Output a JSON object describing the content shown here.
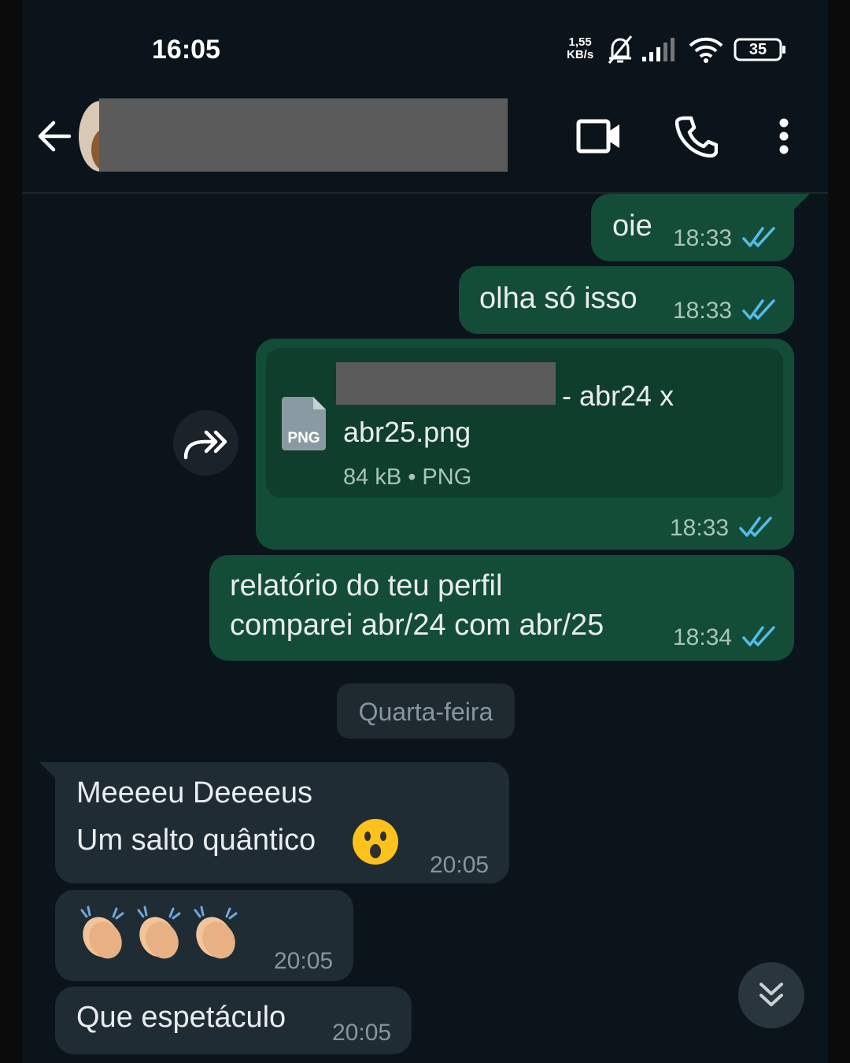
{
  "status_bar": {
    "time": "16:05",
    "net_speed_value": "1,55",
    "net_speed_unit": "KB/s",
    "battery": "35",
    "icons": [
      "mute-bell-icon",
      "signal-icon",
      "wifi-icon",
      "battery-icon"
    ]
  },
  "header": {
    "icons": [
      "back-arrow-icon",
      "video-call-icon",
      "phone-icon",
      "more-vert-icon"
    ]
  },
  "messages": {
    "m1": {
      "text": "oie",
      "time": "18:33"
    },
    "m2": {
      "text": "olha só isso",
      "time": "18:33"
    },
    "file": {
      "name_visible": "- abr24 x",
      "name_line2": "abr25.png",
      "meta": "84 kB • PNG",
      "icon_label": "PNG",
      "time": "18:33"
    },
    "m4": {
      "line1": "relatório do teu perfil",
      "line2": "comparei abr/24 com abr/25",
      "time": "18:34"
    }
  },
  "date_divider": "Quarta-feira",
  "incoming": {
    "i1": {
      "line1": "Meeeeu Deeeeus",
      "line2": "Um salto quântico",
      "time": "20:05"
    },
    "i2": {
      "time": "20:05"
    },
    "i3": {
      "text": "Que espetáculo",
      "time": "20:05"
    }
  },
  "colors": {
    "outgoing_bubble": "#134d37",
    "incoming_bubble": "#202c33",
    "read_ticks": "#53bdeb",
    "background": "#0b141a"
  }
}
